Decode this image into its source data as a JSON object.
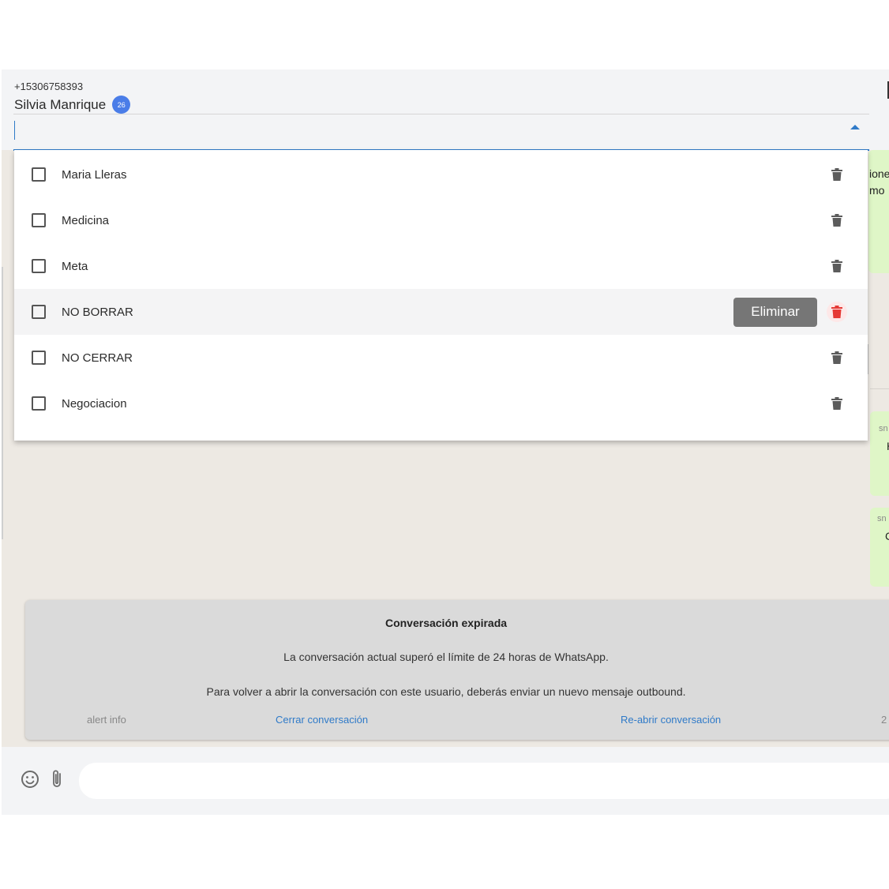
{
  "contact": {
    "phone": "+15306758393",
    "name": "Silvia Manrique",
    "badge_count": "26"
  },
  "tag_search": {
    "value": "",
    "placeholder": ""
  },
  "tag_options": [
    {
      "label": "Maria Lleras",
      "checked": false,
      "hovered": false
    },
    {
      "label": "Medicina",
      "checked": false,
      "hovered": false
    },
    {
      "label": "Meta",
      "checked": false,
      "hovered": false
    },
    {
      "label": "NO BORRAR",
      "checked": false,
      "hovered": true
    },
    {
      "label": "NO CERRAR",
      "checked": false,
      "hovered": false
    },
    {
      "label": "Negociacion",
      "checked": false,
      "hovered": false
    }
  ],
  "delete_tooltip": "Eliminar",
  "bubble_fragments": {
    "first": [
      "ione",
      "mo"
    ],
    "second": {
      "sender": "sn",
      "text": "H"
    },
    "third": {
      "sender": "sn",
      "text": "C"
    }
  },
  "alert": {
    "title": "Conversación expirada",
    "line1": "La conversación actual superó el límite de 24 horas de WhatsApp.",
    "line2": "Para volver a abrir la conversación con este usuario, deberás enviar un nuevo mensaje outbound.",
    "info_label": "alert info",
    "close_label": "Cerrar conversación",
    "reopen_label": "Re-abrir conversación",
    "trailing": "2"
  },
  "composer": {
    "placeholder": ""
  },
  "colors": {
    "accent": "#2f7ac8",
    "badge": "#4a7de8",
    "delete_active": "#e53935",
    "bubble": "#dff6c7",
    "chat_bg": "#ede9e3"
  },
  "icons": {
    "trash": "trash-icon",
    "emoji": "emoji-icon",
    "attach": "paperclip-icon",
    "dropdown": "chevron-up-icon"
  }
}
